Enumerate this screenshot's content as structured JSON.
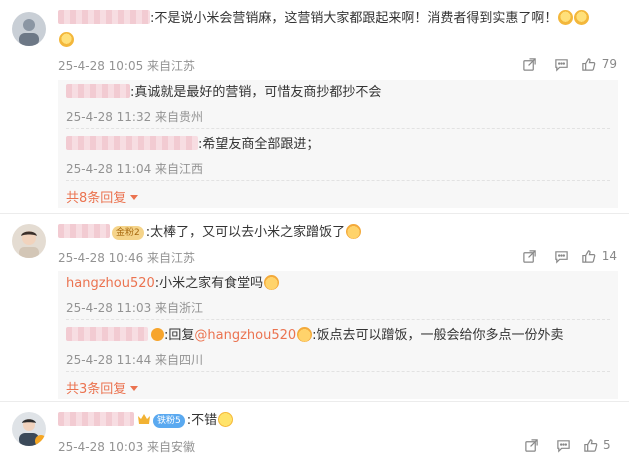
{
  "comments": [
    {
      "author": "",
      "text": ":不是说小米会营销麻，这营销大家都跟起来啊！消费者得到实惠了啊！",
      "time": "25-4-28 10:05 来自江苏",
      "likes": "79",
      "emoji": [
        "pray",
        "pray",
        "pray"
      ],
      "replies": [
        {
          "author": "",
          "text": ":真诚就是最好的营销，可惜友商抄都抄不会",
          "time": "25-4-28 11:32 来自贵州"
        },
        {
          "author": "",
          "text": ":希望友商全部跟进；",
          "time": "25-4-28 11:04 来自江西"
        }
      ],
      "more": "共8条回复"
    },
    {
      "author": "",
      "badge": "金粉2",
      "text": ":太棒了，又可以去小米之家蹭饭了",
      "time": "25-4-28 10:46 来自江苏",
      "likes": "14",
      "replies": [
        {
          "author": "hangzhou520",
          "text": ":小米之家有食堂吗",
          "time": "25-4-28 11:03 来自浙江"
        },
        {
          "author": "",
          "text_prefix": ":回复",
          "mention": "@hangzhou520",
          "text": ":饭点去可以蹭饭，一般会给你多点一份外卖",
          "time": "25-4-28 11:44 来自四川"
        }
      ],
      "more": "共3条回复"
    },
    {
      "author": "",
      "badge": "铁粉5",
      "text": ":不错",
      "time": "25-4-28 10:03 来自安徽",
      "likes": "5"
    }
  ],
  "icons": {
    "share": "share-icon",
    "comment": "comment-icon",
    "like": "like-icon"
  },
  "colors": {
    "link": "#eb7350",
    "meta": "#939393",
    "reply_bg": "#f7f7f7"
  }
}
